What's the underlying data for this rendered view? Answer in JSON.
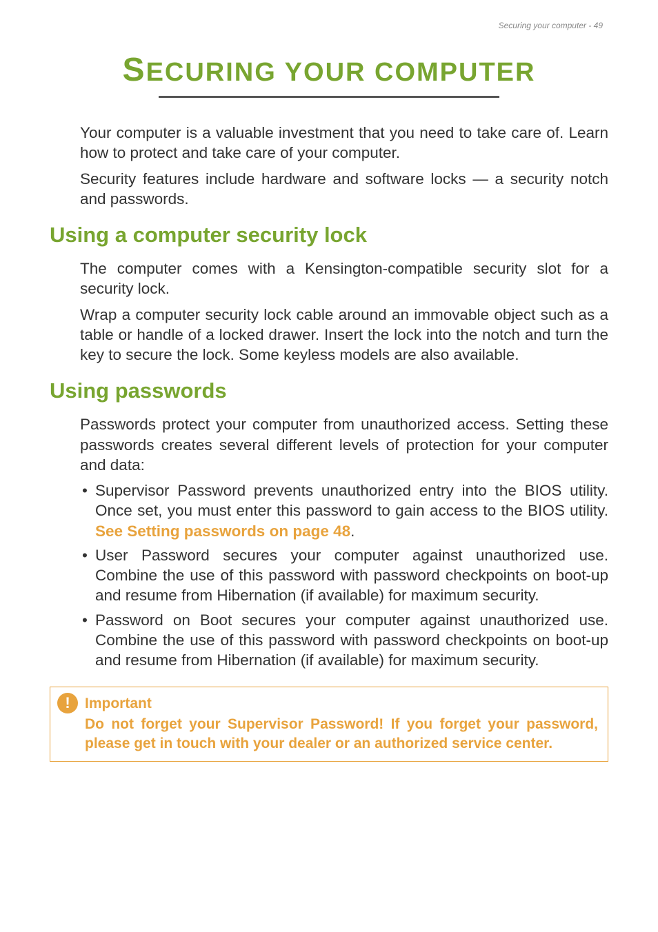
{
  "header": {
    "running_title": "Securing your computer - 49"
  },
  "title": {
    "first": "S",
    "rest": "ECURING YOUR COMPUTER"
  },
  "intro": {
    "p1": "Your computer is a valuable investment that you need to take care of. Learn how to protect and take care of your computer.",
    "p2": "Security features include hardware and software locks — a security notch and passwords."
  },
  "section1": {
    "heading": "Using a computer security lock",
    "p1": "The computer comes with a Kensington-compatible security slot for a security lock.",
    "p2": "Wrap a computer security lock cable around an immovable object such as a table or handle of a locked drawer. Insert the lock into the notch and turn the key to secure the lock. Some keyless models are also available."
  },
  "section2": {
    "heading": "Using passwords",
    "p1": "Passwords protect your computer from unauthorized access. Setting these passwords creates several different levels of protection for your computer and data:",
    "bullets": {
      "b1_pre": "Supervisor Password prevents unauthorized entry into the BIOS utility. Once set, you must enter this password to gain access to the BIOS utility. ",
      "b1_link": "See Setting passwords on page 48",
      "b1_post": ".",
      "b2": "User Password secures your computer against unauthorized use. Combine the use of this password with password checkpoints on boot-up and resume from Hibernation (if available) for maximum security.",
      "b3": "Password on Boot secures your computer against unauthorized use. Combine the use of this password with password checkpoints on boot-up and resume from Hibernation (if available) for maximum security."
    }
  },
  "important": {
    "label": "Important",
    "body": "Do not forget your Supervisor Password! If you forget your password, please get in touch with your dealer or an authorized service center."
  }
}
